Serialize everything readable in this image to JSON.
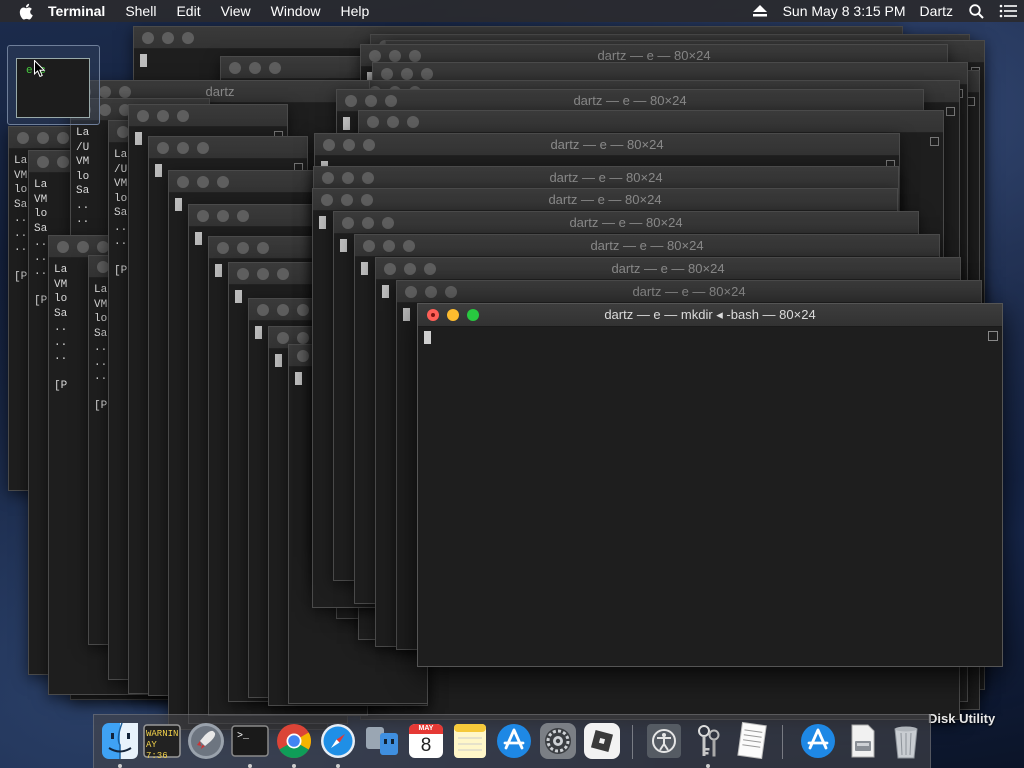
{
  "menubar": {
    "app_name": "Terminal",
    "items": [
      "Shell",
      "Edit",
      "View",
      "Window",
      "Help"
    ],
    "clock": "Sun May 8  3:15 PM",
    "user": "Dartz"
  },
  "front_window": {
    "title": "dartz — e — mkdir ◂ -bash — 80×24"
  },
  "back_window_title": "dartz — e — 80×24",
  "partial_titles": {
    "dartz_short": "dartz"
  },
  "terminal_fragments": {
    "col_a": [
      "La",
      "VM",
      "lo",
      "Sa",
      "..",
      "..",
      "..",
      "",
      "[P"
    ],
    "col_b": [
      "La",
      "/U",
      "VM",
      "lo",
      "Sa",
      "..",
      "..",
      "",
      "[P"
    ],
    "col_c": [
      "La",
      "VM",
      "lo",
      "Sa",
      "..",
      "..",
      "..",
      "",
      "[P"
    ]
  },
  "thumbnail": {
    "text": "e c"
  },
  "dock_label": "Disk Utility",
  "dock": {
    "items": [
      {
        "name": "finder",
        "running": true
      },
      {
        "name": "console",
        "running": false,
        "line1": "WARNIN",
        "line2": "AY 7:36"
      },
      {
        "name": "launchpad",
        "running": false
      },
      {
        "name": "terminal",
        "running": true,
        "prompt": ">_"
      },
      {
        "name": "chrome",
        "running": true
      },
      {
        "name": "safari",
        "running": true
      },
      {
        "name": "migration",
        "running": false
      },
      {
        "name": "calendar",
        "running": false,
        "month": "MAY",
        "day": "8"
      },
      {
        "name": "notes",
        "running": false
      },
      {
        "name": "app-store",
        "running": false
      },
      {
        "name": "system-preferences",
        "running": false
      },
      {
        "name": "roblox",
        "running": false
      },
      {
        "name": "accessibility",
        "running": false
      },
      {
        "name": "keychain",
        "running": true
      },
      {
        "name": "textedit",
        "running": false
      },
      {
        "name": "app-store-2",
        "running": false
      },
      {
        "name": "installer",
        "running": false
      },
      {
        "name": "trash",
        "running": false
      }
    ]
  },
  "colors": {
    "close": "#fe5f57",
    "minimize": "#febc2e",
    "zoom": "#28c840",
    "terminal_bg": "#1e1e1e"
  }
}
